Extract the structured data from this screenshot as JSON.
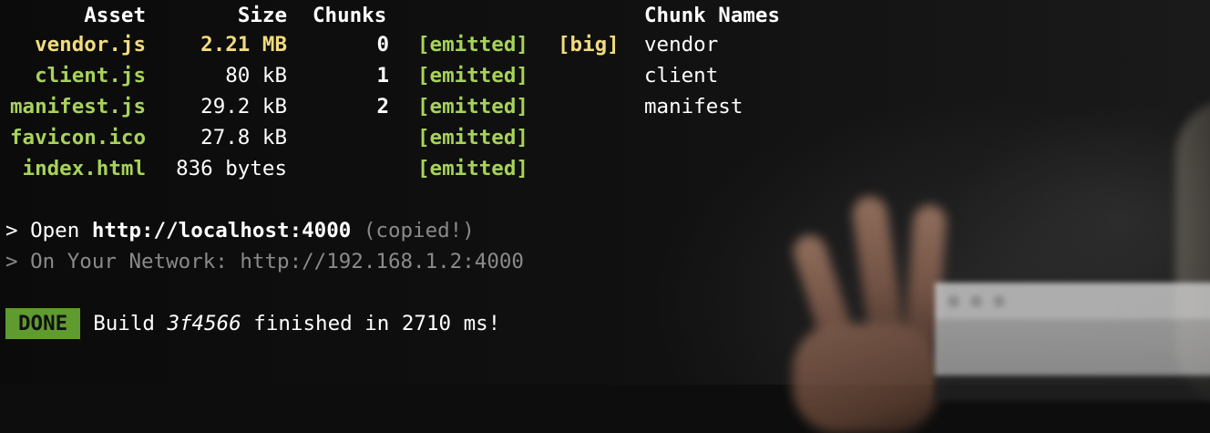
{
  "table": {
    "headers": {
      "asset": "Asset",
      "size": "Size",
      "chunks": "Chunks",
      "chunk_names": "Chunk Names"
    },
    "rows": [
      {
        "asset": "vendor.js",
        "size": "2.21 MB",
        "chunks": "0",
        "emitted": "[emitted]",
        "big": "[big]",
        "chunk_name": "vendor",
        "highlight": "yellow"
      },
      {
        "asset": "client.js",
        "size": "80 kB",
        "chunks": "1",
        "emitted": "[emitted]",
        "big": "",
        "chunk_name": "client",
        "highlight": "green"
      },
      {
        "asset": "manifest.js",
        "size": "29.2 kB",
        "chunks": "2",
        "emitted": "[emitted]",
        "big": "",
        "chunk_name": "manifest",
        "highlight": "green"
      },
      {
        "asset": "favicon.ico",
        "size": "27.8 kB",
        "chunks": "",
        "emitted": "[emitted]",
        "big": "",
        "chunk_name": "",
        "highlight": "green"
      },
      {
        "asset": "index.html",
        "size": "836 bytes",
        "chunks": "",
        "emitted": "[emitted]",
        "big": "",
        "chunk_name": "",
        "highlight": "green"
      }
    ]
  },
  "server": {
    "open_prefix": "> Open ",
    "open_url": "http://localhost:4000",
    "copied_note": "(copied!)",
    "network_prefix": "> On Your Network: ",
    "network_url": "http://192.168.1.2:4000"
  },
  "build": {
    "badge": "DONE",
    "text_before": "Build ",
    "hash": "3f4566",
    "text_after": " finished in 2710 ms!"
  },
  "colors": {
    "asset_green": "#a7d35a",
    "asset_yellow": "#f0dc7e",
    "done_badge_bg": "#5f9b2f",
    "muted_gray": "#8a8a8a",
    "background": "#0d0d0d"
  }
}
